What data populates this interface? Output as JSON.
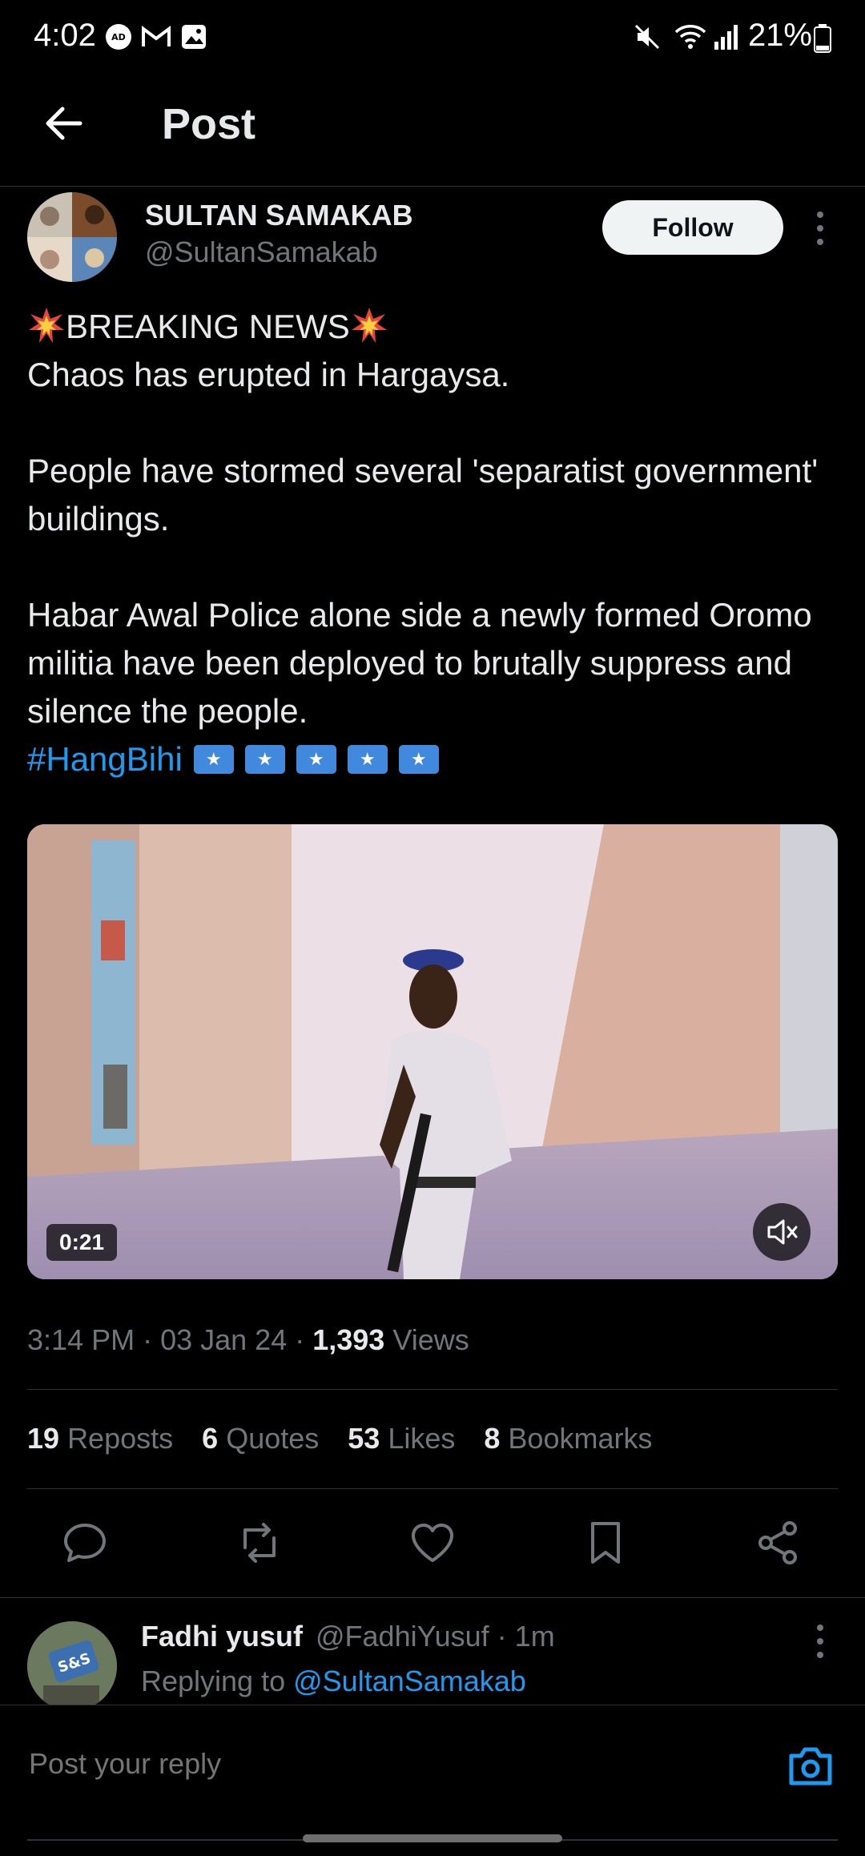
{
  "status_bar": {
    "time": "4:02",
    "battery": "21%"
  },
  "header": {
    "title": "Post"
  },
  "author": {
    "name": "SULTAN SAMAKAB",
    "handle": "@SultanSamakab",
    "follow_label": "Follow"
  },
  "post": {
    "line1": "BREAKING NEWS",
    "line2": "Chaos has erupted in Hargaysa.",
    "para2": "People have stormed several 'separatist government' buildings.",
    "para3": "Habar Awal Police alone side a newly formed Oromo militia have been deployed to brutally suppress and silence the people.",
    "hashtag": "#HangBihi"
  },
  "media": {
    "duration": "0:21"
  },
  "meta": {
    "time": "3:14 PM",
    "date": "03 Jan 24",
    "views_count": "1,393",
    "views_label": "Views"
  },
  "stats": [
    {
      "num": "19",
      "label": "Reposts"
    },
    {
      "num": "6",
      "label": "Quotes"
    },
    {
      "num": "53",
      "label": "Likes"
    },
    {
      "num": "8",
      "label": "Bookmarks"
    }
  ],
  "reply": {
    "name": "Fadhi yusuf",
    "handle": "@FadhiYusuf",
    "time": "1m",
    "replying_prefix": "Replying to",
    "replying_to": "@SultanSamakab"
  },
  "composer": {
    "placeholder": "Post your reply"
  },
  "colors": {
    "accent": "#1d9bf0",
    "background": "#000000",
    "muted": "#71767b"
  }
}
